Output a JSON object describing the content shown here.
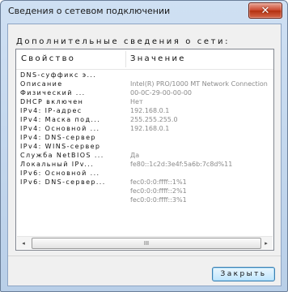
{
  "window": {
    "title": "Сведения о сетевом подключении",
    "close_glyph": "✕"
  },
  "subtitle": "Дополнительные сведения о сети:",
  "table": {
    "columns": [
      "Свойство",
      "Значение"
    ],
    "rows": [
      {
        "prop": "DNS-суффикс э...",
        "value": ""
      },
      {
        "prop": "Описание",
        "value": "Intel(R) PRO/1000 MT Network Connection"
      },
      {
        "prop": "Физический ...",
        "value": "00-0C-29-00-00-00"
      },
      {
        "prop": "DHCP включен",
        "value": "Нет"
      },
      {
        "prop": "IPv4: IP-адрес",
        "value": "192.168.0.1"
      },
      {
        "prop": "IPv4: Маска под...",
        "value": "255.255.255.0"
      },
      {
        "prop": "IPv4: Основной ...",
        "value": "192.168.0.1"
      },
      {
        "prop": "IPv4: DNS-сервер",
        "value": ""
      },
      {
        "prop": "IPv4: WINS-сервер",
        "value": ""
      },
      {
        "prop": "Служба NetBIOS ...",
        "value": "Да"
      },
      {
        "prop": "Локальный IPv...",
        "value": "fe80::1c2d:3e4f:5a6b:7c8d%11"
      },
      {
        "prop": "IPv6: Основной ...",
        "value": ""
      },
      {
        "prop": "IPv6: DNS-сервер...",
        "value": "fec0:0:0:ffff::1%1"
      },
      {
        "prop": "",
        "value": "fec0:0:0:ffff::2%1"
      },
      {
        "prop": "",
        "value": "fec0:0:0:ffff::3%1"
      }
    ]
  },
  "scrollbar": {
    "left_arrow": "◂",
    "right_arrow": "▸",
    "grip": "III"
  },
  "buttons": {
    "close_label": "Закрыть"
  }
}
